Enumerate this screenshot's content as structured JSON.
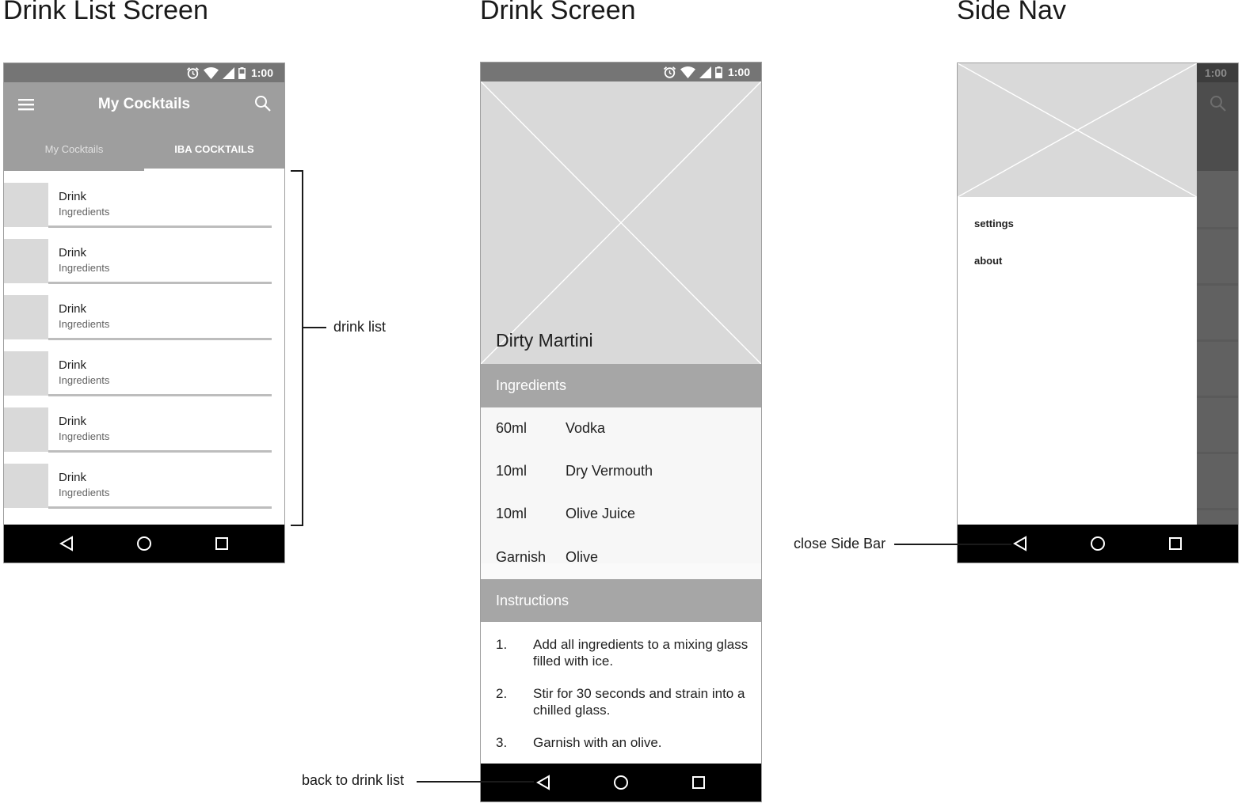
{
  "titles": {
    "drink_list_screen": "Drink List Screen",
    "drink_screen": "Drink Screen",
    "side_nav": "Side Nav"
  },
  "status_bar": {
    "time": "1:00"
  },
  "drink_list": {
    "app_title": "My Cocktails",
    "tabs": [
      {
        "label": "My Cocktails",
        "active": false
      },
      {
        "label": "IBA COCKTAILS",
        "active": true
      }
    ],
    "items": [
      {
        "name": "Drink",
        "subtitle": "Ingredients"
      },
      {
        "name": "Drink",
        "subtitle": "Ingredients"
      },
      {
        "name": "Drink",
        "subtitle": "Ingredients"
      },
      {
        "name": "Drink",
        "subtitle": "Ingredients"
      },
      {
        "name": "Drink",
        "subtitle": "Ingredients"
      },
      {
        "name": "Drink",
        "subtitle": "Ingredients"
      }
    ]
  },
  "drink": {
    "title": "Dirty Martini",
    "ingredients_header": "Ingredients",
    "ingredients": [
      {
        "amount": "60ml",
        "item": "Vodka"
      },
      {
        "amount": "10ml",
        "item": "Dry Vermouth"
      },
      {
        "amount": "10ml",
        "item": "Olive Juice"
      },
      {
        "amount": "Garnish",
        "item": "Olive"
      }
    ],
    "instructions_header": "Instructions",
    "steps": [
      {
        "num": "1.",
        "text": "Add all ingredients to a mixing glass filled with ice."
      },
      {
        "num": "2.",
        "text": "Stir for 30 seconds and strain into a chilled glass."
      },
      {
        "num": "3.",
        "text": "Garnish with an olive."
      }
    ]
  },
  "side_nav": {
    "items": [
      {
        "label": "settings"
      },
      {
        "label": "about"
      }
    ]
  },
  "annotations": {
    "drink_list": "drink list",
    "back_to_drink_list": "back to drink list",
    "close_side_bar": "close Side Bar"
  },
  "icons": {
    "menu": "hamburger-menu-icon",
    "search": "search-icon",
    "back": "back-triangle-icon",
    "home": "home-circle-icon",
    "recents": "recents-square-icon",
    "alarm": "alarm-icon",
    "wifi": "wifi-icon",
    "signal": "signal-icon",
    "battery": "battery-icon"
  }
}
